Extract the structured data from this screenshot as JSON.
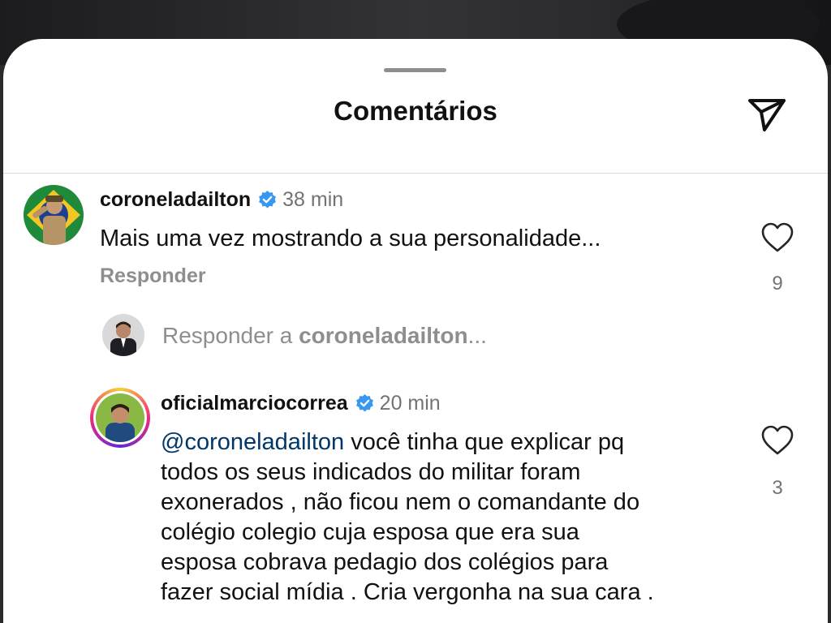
{
  "header": {
    "title": "Comentários",
    "share_icon": "send-icon"
  },
  "comments": [
    {
      "username": "coroneladailton",
      "verified": true,
      "time": "38 min",
      "text": "Mais uma vez mostrando a sua personalidade...",
      "reply_label": "Responder",
      "likes": "9",
      "replies_prefix": "Responder a ",
      "replies_user": "coroneladailton",
      "replies_suffix": "..."
    },
    {
      "username": "oficialmarciocorrea",
      "verified": true,
      "time": "20 min",
      "mention": "@coroneladailton",
      "lines": [
        " você tinha que explicar pq",
        "todos os seus indicados do militar foram",
        "exonerados , não ficou nem o comandante do",
        "colégio colegio cuja esposa que  era sua",
        "esposa cobrava pedagio dos colégios para",
        "fazer social mídia . Cria vergonha na sua cara ."
      ],
      "likes": "3"
    }
  ],
  "colors": {
    "verified": "#3897f0",
    "mention": "#00376b",
    "secondary_text": "#8e8e8e"
  }
}
